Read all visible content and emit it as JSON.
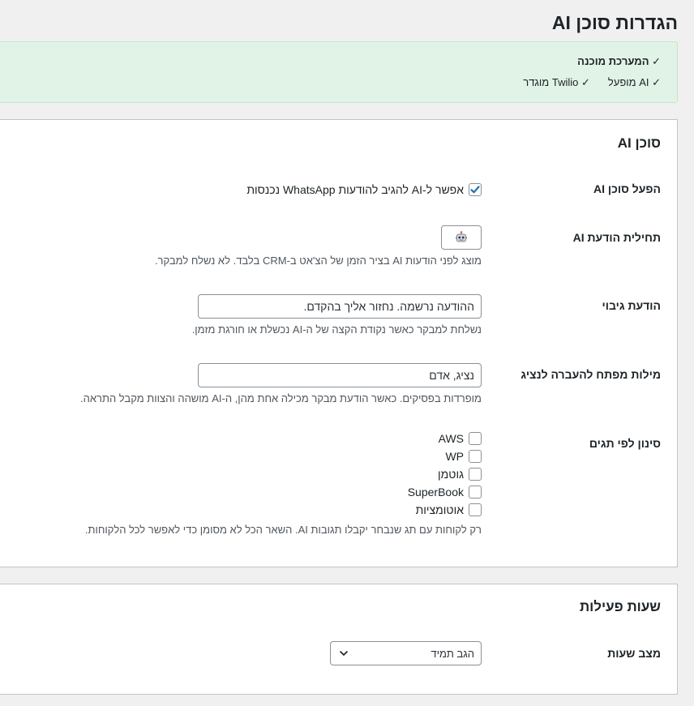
{
  "page": {
    "title": "הגדרות סוכן AI"
  },
  "notice": {
    "line1": "✓ המערכת מוכנה",
    "items": [
      "✓ AI מופעל",
      "✓ Twilio מוגדר"
    ]
  },
  "agent_section": {
    "title": "סוכן AI",
    "enable": {
      "label": "הפעל סוכן AI",
      "checkbox_text": "אפשר ל-AI להגיב להודעות WhatsApp נכנסות",
      "checked": true
    },
    "prefix": {
      "label": "תחילית הודעת AI",
      "value": "🤖",
      "description": "מוצג לפני הודעות AI בציר הזמן של הצ'אט ב-CRM בלבד. לא נשלח למבקר."
    },
    "fallback": {
      "label": "הודעת גיבוי",
      "value": "ההודעה נרשמה. נחזור אליך בהקדם.",
      "description": "נשלחת למבקר כאשר נקודת הקצה של ה-AI נכשלת או חורגת מזמן."
    },
    "handoff": {
      "label": "מילות מפתח להעברה לנציג",
      "value": "נציג, אדם",
      "description": "מופרדות בפסיקים. כאשר הודעת מבקר מכילה אחת מהן, ה-AI מושהה והצוות מקבל התראה."
    },
    "tags": {
      "label": "סינון לפי תגים",
      "options": [
        {
          "label": "AWS",
          "checked": false
        },
        {
          "label": "WP",
          "checked": false
        },
        {
          "label": "גוטמן",
          "checked": false
        },
        {
          "label": "SuperBook",
          "checked": false
        },
        {
          "label": "אוטומציות",
          "checked": false
        }
      ],
      "description": "רק לקוחות עם תג שנבחר יקבלו תגובות AI. השאר הכל לא מסומן כדי לאפשר לכל הלקוחות."
    }
  },
  "hours_section": {
    "title": "שעות פעילות",
    "mode": {
      "label": "מצב שעות",
      "selected": "הגב תמיד"
    }
  },
  "colors": {
    "notice_bg": "#e1f3e6",
    "accent": "#2271b1"
  }
}
